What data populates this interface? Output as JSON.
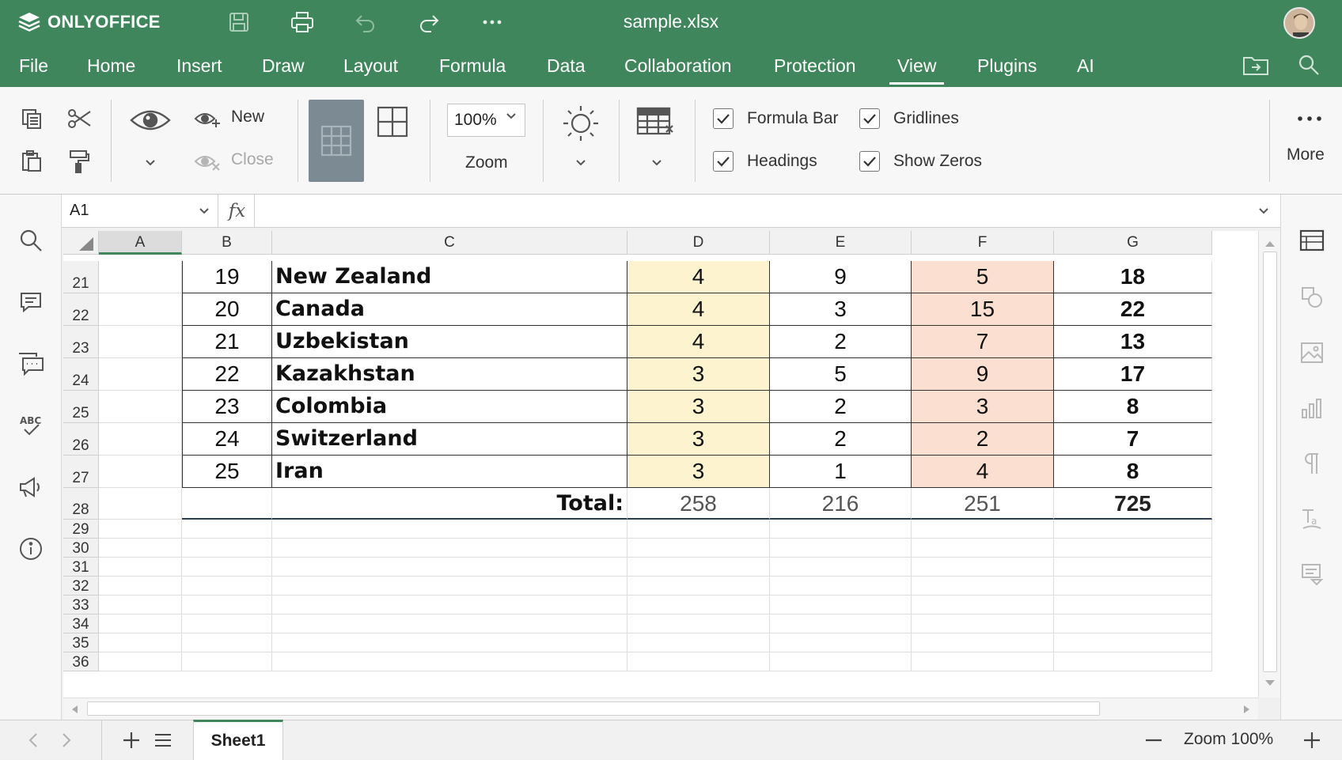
{
  "app": {
    "brand": "ONLYOFFICE",
    "doc_title": "sample.xlsx",
    "accent": "#40865c"
  },
  "title_tools": [
    "save-icon",
    "print-icon",
    "undo-icon",
    "redo-icon",
    "more-horizontal-icon"
  ],
  "menu": {
    "items": [
      {
        "label": "File",
        "active": false
      },
      {
        "label": "Home",
        "active": false
      },
      {
        "label": "Insert",
        "active": false
      },
      {
        "label": "Draw",
        "active": false
      },
      {
        "label": "Layout",
        "active": false
      },
      {
        "label": "Formula",
        "active": false
      },
      {
        "label": "Data",
        "active": false
      },
      {
        "label": "Collaboration",
        "active": false
      },
      {
        "label": "Protection",
        "active": false
      },
      {
        "label": "View",
        "active": true
      },
      {
        "label": "Plugins",
        "active": false
      },
      {
        "label": "AI",
        "active": false
      }
    ]
  },
  "toolbar": {
    "new_label": "New",
    "close_label": "Close",
    "zoom_value": "100%",
    "zoom_label": "Zoom",
    "more_label": "More",
    "checkboxes": {
      "formula_bar": {
        "label": "Formula Bar",
        "checked": true
      },
      "gridlines": {
        "label": "Gridlines",
        "checked": true
      },
      "headings": {
        "label": "Headings",
        "checked": true
      },
      "show_zeros": {
        "label": "Show Zeros",
        "checked": true
      }
    }
  },
  "formula_bar": {
    "name_box": "A1",
    "fx_label": "fx",
    "value": ""
  },
  "sheet": {
    "columns": [
      "A",
      "B",
      "C",
      "D",
      "E",
      "F",
      "G"
    ],
    "data_rows": [
      {
        "row": "21",
        "rank": "19",
        "country": "New Zealand",
        "d": "4",
        "e": "9",
        "f": "5",
        "g": "18"
      },
      {
        "row": "22",
        "rank": "20",
        "country": "Canada",
        "d": "4",
        "e": "3",
        "f": "15",
        "g": "22"
      },
      {
        "row": "23",
        "rank": "21",
        "country": "Uzbekistan",
        "d": "4",
        "e": "2",
        "f": "7",
        "g": "13"
      },
      {
        "row": "24",
        "rank": "22",
        "country": "Kazakhstan",
        "d": "3",
        "e": "5",
        "f": "9",
        "g": "17"
      },
      {
        "row": "25",
        "rank": "23",
        "country": "Colombia",
        "d": "3",
        "e": "2",
        "f": "3",
        "g": "8"
      },
      {
        "row": "26",
        "rank": "24",
        "country": "Switzerland",
        "d": "3",
        "e": "2",
        "f": "2",
        "g": "7"
      },
      {
        "row": "27",
        "rank": "25",
        "country": "Iran",
        "d": "3",
        "e": "1",
        "f": "4",
        "g": "8"
      }
    ],
    "total_row": {
      "row": "28",
      "label": "Total:",
      "d": "258",
      "e": "216",
      "f": "251",
      "g": "725"
    },
    "empty_rows": [
      "29",
      "30",
      "31",
      "32",
      "33",
      "34",
      "35",
      "36"
    ],
    "fill_colors": {
      "col_d": "#fdf3cf",
      "col_f": "#fbe0d2"
    }
  },
  "sidebar_left": [
    "search-icon",
    "comment-icon",
    "chat-icon",
    "spellcheck-icon",
    "feedback-icon",
    "info-icon"
  ],
  "sidebar_right": [
    "cell-settings-icon",
    "shape-settings-icon",
    "image-settings-icon",
    "chart-settings-icon",
    "paragraph-settings-icon",
    "text-art-icon",
    "form-settings-icon"
  ],
  "status": {
    "sheet_tab": "Sheet1",
    "zoom_text": "Zoom 100%"
  }
}
